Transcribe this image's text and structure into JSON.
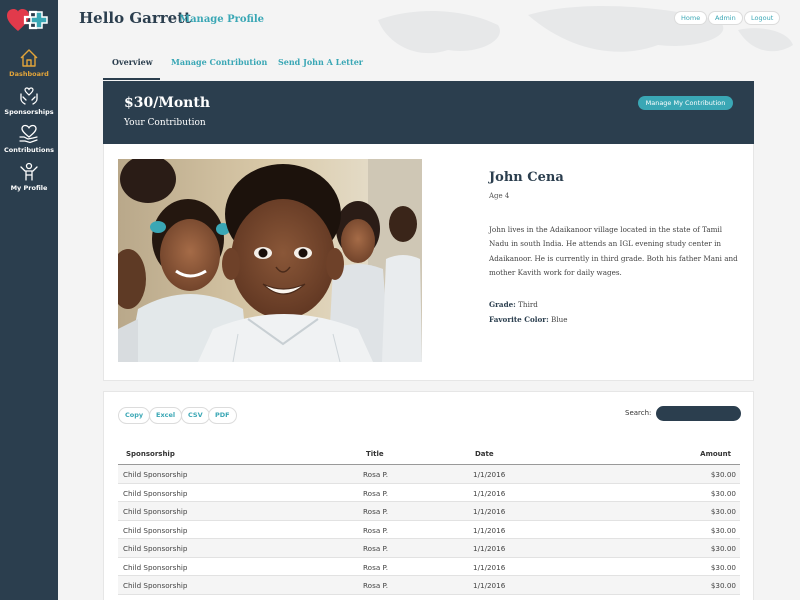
{
  "sidebar": {
    "items": [
      {
        "label": "Dashboard",
        "icon": "house-icon"
      },
      {
        "label": "Sponsorships",
        "icon": "hands-heart-icon"
      },
      {
        "label": "Contributions",
        "icon": "heart-hand-icon"
      },
      {
        "label": "My Profile",
        "icon": "person-icon"
      }
    ]
  },
  "header": {
    "greeting": "Hello Garrett",
    "manage_profile": "Manage Profile",
    "links": [
      "Home",
      "Admin",
      "Logout"
    ]
  },
  "tabs": [
    "Overview",
    "Manage Contribution",
    "Send John A Letter"
  ],
  "contribution": {
    "amount": "$30/Month",
    "label": "Your Contribution",
    "manage_button": "Manage My Contribution"
  },
  "child": {
    "name": "John Cena",
    "age": "Age 4",
    "bio": "John lives in the Adaikanoor village located in the state of Tamil Nadu in south India. He attends an IGL evening study center in Adaikanoor. He is currently in third grade. Both his father Mani and mother Kavith work for daily wages.",
    "grade_label": "Grade:",
    "grade": "Third",
    "color_label": "Favorite Color:",
    "color": "Blue"
  },
  "table": {
    "export_buttons": [
      "Copy",
      "Excel",
      "CSV",
      "PDF"
    ],
    "search_label": "Search:",
    "search_value": "",
    "columns": [
      "Sponsorship",
      "Title",
      "Date",
      "Amount"
    ],
    "rows": [
      [
        "Child Sponsorship",
        "Rosa P.",
        "1/1/2016",
        "$30.00"
      ],
      [
        "Child Sponsorship",
        "Rosa P.",
        "1/1/2016",
        "$30.00"
      ],
      [
        "Child Sponsorship",
        "Rosa P.",
        "1/1/2016",
        "$30.00"
      ],
      [
        "Child Sponsorship",
        "Rosa P.",
        "1/1/2016",
        "$30.00"
      ],
      [
        "Child Sponsorship",
        "Rosa P.",
        "1/1/2016",
        "$30.00"
      ],
      [
        "Child Sponsorship",
        "Rosa P.",
        "1/1/2016",
        "$30.00"
      ],
      [
        "Child Sponsorship",
        "Rosa P.",
        "1/1/2016",
        "$30.00"
      ]
    ]
  },
  "colors": {
    "navy": "#2b3e4e",
    "teal": "#3aa7b5",
    "accent": "#e2a43a",
    "logo_red": "#e23a4b"
  }
}
